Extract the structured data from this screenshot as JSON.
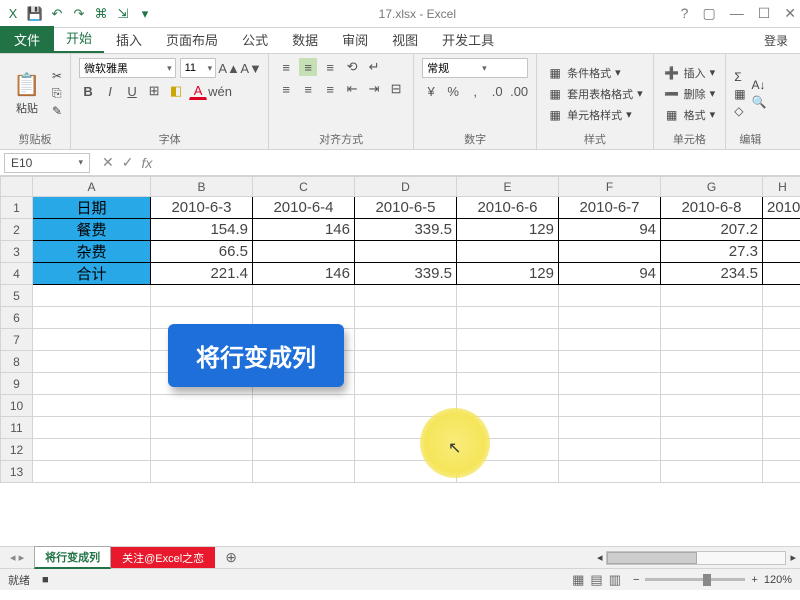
{
  "window": {
    "title": "17.xlsx - Excel",
    "help_icon": "?",
    "ribbon_toggle": "▢",
    "min": "—",
    "max": "☐",
    "close": "✕",
    "login": "登录"
  },
  "qat": {
    "excel": "X",
    "save": "💾",
    "undo": "↶",
    "redo": "↷",
    "extra1": "⌘",
    "extra2": "⇲",
    "dd": "▾"
  },
  "tabs": {
    "file": "文件",
    "t": [
      "开始",
      "插入",
      "页面布局",
      "公式",
      "数据",
      "审阅",
      "视图",
      "开发工具"
    ],
    "active": 0
  },
  "ribbon": {
    "clipboard": {
      "label": "剪贴板",
      "paste": "粘贴",
      "cut": "✂",
      "copy": "⎘",
      "brush": "✎"
    },
    "font": {
      "label": "字体",
      "name": "微软雅黑",
      "size": "11",
      "b": "B",
      "i": "I",
      "u": "U",
      "border": "⊞",
      "fill": "◧",
      "color": "A",
      "grow": "A▲",
      "shrink": "A▼",
      "phonetic": "wén"
    },
    "align": {
      "label": "对齐方式",
      "tl": "≡",
      "tc": "≡",
      "tr": "≡",
      "ml": "≡",
      "mc": "≡",
      "mr": "≡",
      "il": "⇤",
      "ir": "⇥",
      "wrap": "↵",
      "merge": "⊟",
      "orient": "⟲"
    },
    "number": {
      "label": "数字",
      "fmt": "常规",
      "cur": "¥",
      "pct": "%",
      "comma": ",",
      "inc": ".0",
      "dec": ".00"
    },
    "styles": {
      "label": "样式",
      "cond": "条件格式",
      "table": "套用表格格式",
      "cell": "单元格样式"
    },
    "cells": {
      "label": "单元格",
      "ins": "插入",
      "del": "删除",
      "fmt": "格式"
    },
    "editing": {
      "label": "编辑",
      "sum": "Σ",
      "fill": "▦",
      "clear": "◇",
      "sort": "A↓",
      "find": "🔍"
    }
  },
  "namebox": {
    "ref": "E10"
  },
  "fx": {
    "cancel": "✕",
    "enter": "✓",
    "fx": "fx"
  },
  "cols": [
    "A",
    "B",
    "C",
    "D",
    "E",
    "F",
    "G",
    "H"
  ],
  "rowheads": [
    "1",
    "2",
    "3",
    "4",
    "5",
    "6",
    "7",
    "8",
    "9",
    "10",
    "11",
    "12",
    "13"
  ],
  "head": {
    "a": "日期",
    "dates": [
      "2010-6-3",
      "2010-6-4",
      "2010-6-5",
      "2010-6-6",
      "2010-6-7",
      "2010-6-8",
      "2010"
    ]
  },
  "r2": {
    "a": "餐费",
    "v": [
      "154.9",
      "146",
      "339.5",
      "129",
      "94",
      "207.2",
      ""
    ]
  },
  "r3": {
    "a": "杂费",
    "v": [
      "66.5",
      "",
      "",
      "",
      "",
      "27.3",
      ""
    ]
  },
  "r4": {
    "a": "合计",
    "v": [
      "221.4",
      "146",
      "339.5",
      "129",
      "94",
      "234.5",
      ""
    ]
  },
  "callout": "将行变成列",
  "sheets": {
    "s1": "将行变成列",
    "s2": "关注@Excel之恋",
    "add": "⊕"
  },
  "status": {
    "ready": "就绪",
    "rec": "■",
    "zoom": "120%",
    "minus": "−",
    "plus": "+"
  }
}
